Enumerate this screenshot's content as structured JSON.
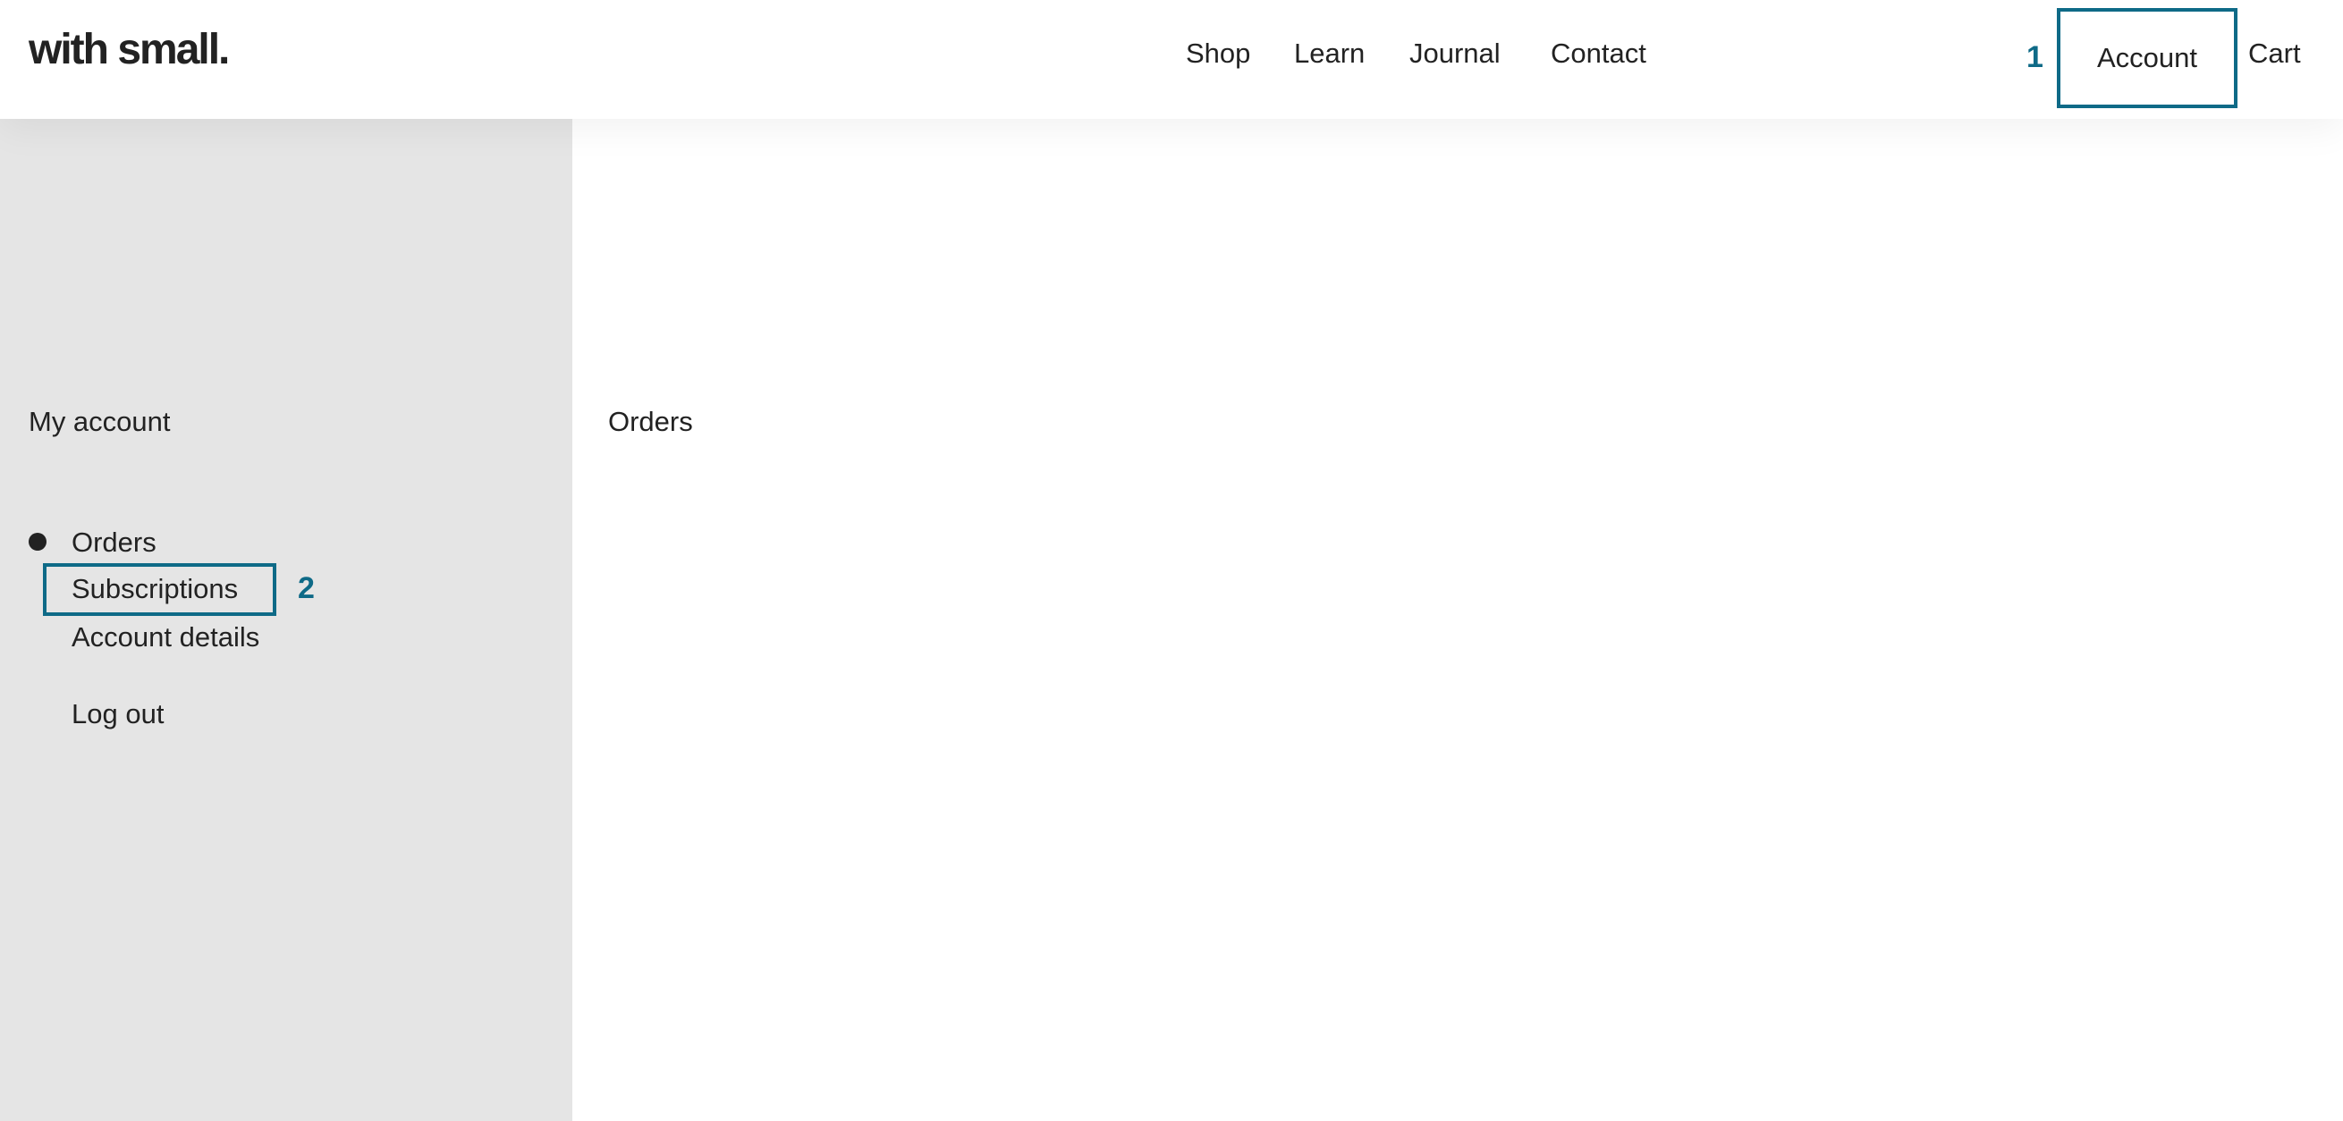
{
  "header": {
    "logo": "with small.",
    "nav": [
      "Shop",
      "Learn",
      "Journal",
      "Contact"
    ],
    "account_label": "Account",
    "cart_label": "Cart"
  },
  "markers": {
    "account": "1",
    "subscriptions": "2"
  },
  "sidebar": {
    "title": "My account",
    "items": [
      "Orders",
      "Subscriptions",
      "Account details",
      "Log out"
    ],
    "active": "Orders"
  },
  "main": {
    "title": "Orders"
  },
  "colors": {
    "highlight": "#0e6a87",
    "sidebar_bg": "#e5e5e5",
    "text": "#222222"
  }
}
